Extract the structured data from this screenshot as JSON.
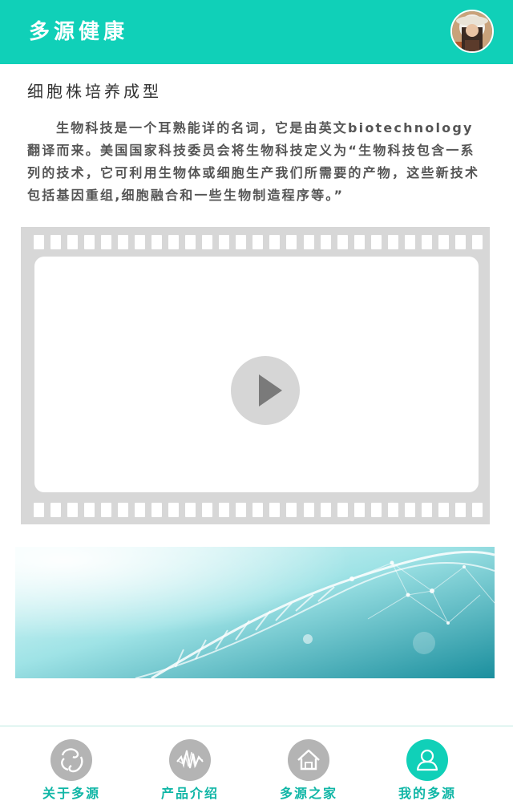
{
  "header": {
    "title": "多源健康",
    "avatar_icon": "user-avatar"
  },
  "article": {
    "title": "细胞株培养成型",
    "body": "生物科技是一个耳熟能详的名词，它是由英文biotechnology翻译而来。美国国家科技委员会将生物科技定义为“生物科技包含一系列的技术，它可利用生物体或细胞生产我们所需要的产物，这些新技术包括基因重组,细胞融合和一些生物制造程序等。”"
  },
  "video": {
    "icon": "play-icon"
  },
  "banner": {
    "icon": "dna-helix-image"
  },
  "nav": {
    "items": [
      {
        "label": "关于多源",
        "icon": "about-icon",
        "active": false
      },
      {
        "label": "产品介绍",
        "icon": "waveform-icon",
        "active": false
      },
      {
        "label": "多源之家",
        "icon": "home-icon",
        "active": false
      },
      {
        "label": "我的多源",
        "icon": "user-icon",
        "active": true
      }
    ]
  },
  "colors": {
    "accent": "#10d0b8",
    "nav_text": "#10b6a6",
    "icon_gray": "#b4b4b4"
  }
}
